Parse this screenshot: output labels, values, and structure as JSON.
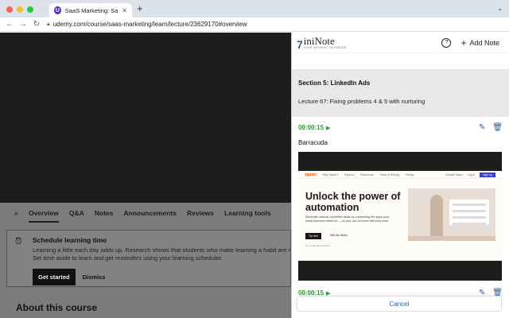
{
  "browser": {
    "tab_title": "SaaS Marketing: SaaS Startup",
    "tab_favicon": "U",
    "url": "udemy.com/course/saas-marketing/learn/lecture/23629170#overview"
  },
  "course": {
    "tabs": [
      "Overview",
      "Q&A",
      "Notes",
      "Announcements",
      "Reviews",
      "Learning tools"
    ],
    "active_tab": "Overview",
    "notice": {
      "title": "Schedule learning time",
      "body_line1": "Learning a little each day adds up. Research shows that students who make learning a habit are more lik",
      "body_line2": "Set time aside to learn and get reminders using your learning scheduler.",
      "primary": "Get started",
      "secondary": "Dismiss"
    },
    "about_title": "About this course"
  },
  "extension": {
    "logo_mark": "7",
    "logo_name": "iniNote",
    "logo_tag": "YOUR INTERNET NOTEBOOK",
    "help": "?",
    "add_note": "Add Note",
    "section": "Section 5: LinkedIn Ads",
    "lecture": "Lecture 67: Fixing problems 4 & 5 with nurturing",
    "notes": [
      {
        "timestamp": "00:00:15",
        "text": "Barracuda"
      },
      {
        "timestamp": "00:00:15",
        "text": ""
      }
    ],
    "cancel": "Cancel"
  },
  "snapshot": {
    "brand": "zapier",
    "nav": [
      "Why Zapier?",
      "Explore",
      "Resources",
      "Plans & Pricing",
      "Pricing"
    ],
    "nav_right": [
      "Contact Sales",
      "Log in",
      "Sign up"
    ],
    "headline": "Unlock the power of automation",
    "sub": "Eliminate manual, repetitive tasks by connecting the apps your small business relies on — so you can do more with less work.",
    "try_label": "Try free",
    "demo_label": "See the demo",
    "fine": "No credit card required"
  },
  "colors": {
    "timestamp": "#2e9a3a",
    "icon": "#1a5fb4",
    "zapier": "#ff4f00"
  }
}
